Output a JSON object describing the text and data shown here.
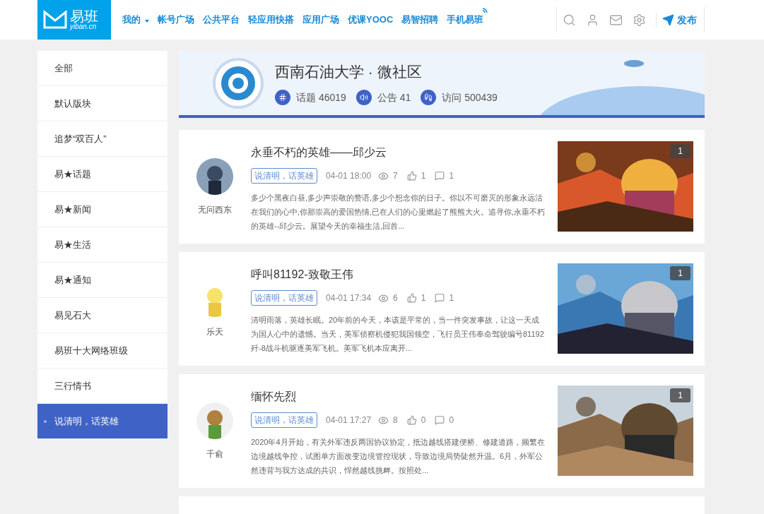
{
  "header": {
    "logo": {
      "name": "易班",
      "domain": "yiban.cn"
    },
    "nav": [
      {
        "label": "我的",
        "dropdown": true,
        "signal": false
      },
      {
        "label": "帐号广场",
        "dropdown": false,
        "signal": false
      },
      {
        "label": "公共平台",
        "dropdown": false,
        "signal": false
      },
      {
        "label": "轻应用快搭",
        "dropdown": false,
        "signal": false
      },
      {
        "label": "应用广场",
        "dropdown": false,
        "signal": false
      },
      {
        "label": "优课YOOC",
        "dropdown": false,
        "signal": false
      },
      {
        "label": "易智招聘",
        "dropdown": false,
        "signal": false
      },
      {
        "label": "手机易班",
        "dropdown": false,
        "signal": true
      }
    ],
    "publish": "发布"
  },
  "sidebar": {
    "items": [
      {
        "label": "全部",
        "selected": false
      },
      {
        "label": "默认版块",
        "selected": false
      },
      {
        "label": "追梦“双百人”",
        "selected": false
      },
      {
        "label": "易★话题",
        "selected": false
      },
      {
        "label": "易★新闻",
        "selected": false
      },
      {
        "label": "易★生活",
        "selected": false
      },
      {
        "label": "易★通知",
        "selected": false
      },
      {
        "label": "易见石大",
        "selected": false
      },
      {
        "label": "易班十大网络班级",
        "selected": false
      },
      {
        "label": "三行情书",
        "selected": false
      },
      {
        "label": "说清明，话英雄",
        "selected": true
      }
    ]
  },
  "community": {
    "title": "西南石油大学 · 微社区",
    "stats": [
      {
        "kind": "topics",
        "text": "话题 46019"
      },
      {
        "kind": "notices",
        "text": "公告 41"
      },
      {
        "kind": "visits",
        "text": "访问 500439"
      }
    ]
  },
  "posts": [
    {
      "author": "无问西东",
      "title": "永垂不朽的英雄——邱少云",
      "tag": "说清明，话英雄",
      "time": "04-01 18:00",
      "views": "7",
      "likes": "1",
      "comments": "1",
      "excerpt": "多少个黑夜白昼,多少声崇敬的赞语,多少个想念你的日子。你以不可磨灭的形象永远活在我们的心中,你那崇高的爱国热情,已在人们的心里燃起了熊熊大火。追寻你,永垂不朽的英雄--邱少云。展望今天的幸福生活,回首...",
      "image_count": "1"
    },
    {
      "author": "乐天",
      "title": "呼叫81192-致敬王伟",
      "tag": "说清明，话英雄",
      "time": "04-01 17:34",
      "views": "6",
      "likes": "1",
      "comments": "1",
      "excerpt": "清明雨落，英雄长眠。20年前的今天，本该是平常的，当一件突发事故，让这一天成为国人心中的遗憾。当天，美军侦察机侵犯我国领空，飞行员王伟奉命驾驶编号81192 歼-8战斗机驱逐美军飞机。美军飞机本应离开...",
      "image_count": "1"
    },
    {
      "author": "千俞",
      "title": "缅怀先烈",
      "tag": "说清明，话英雄",
      "time": "04-01 17:27",
      "views": "8",
      "likes": "0",
      "comments": "0",
      "excerpt": "2020年4月开始，有关外军违反两国协议协定，抵边越线搭建便桥、修建道路，频繁在边境越线争控，试图单方面改变边境管控现状，导致边境局势陡然升温。6月，外军公然违背与我方达成的共识，悍然越线挑衅。按照处...",
      "image_count": "1"
    }
  ]
}
